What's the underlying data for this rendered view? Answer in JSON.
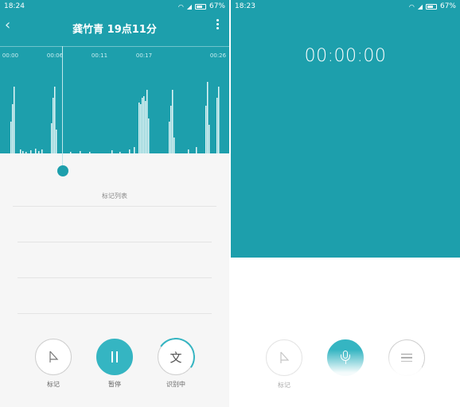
{
  "colors": {
    "teal": "#1d9fac",
    "accent": "#35b5c2",
    "panel": "#f6f6f6"
  },
  "left": {
    "status": {
      "time": "18:24",
      "battery": "67%"
    },
    "title": "龚竹青  19点11分",
    "timeline_ticks": [
      "00:00",
      "00:06",
      "00:11",
      "00:17",
      "00:26"
    ],
    "marks_list_title": "标记列表",
    "controls": {
      "mark_label": "标记",
      "pause_label": "暂停",
      "transcribe_label": "识别中",
      "transcribe_glyph": "文"
    },
    "icons": [
      "back-icon",
      "more-icon",
      "flag-icon",
      "pause-icon"
    ]
  },
  "right": {
    "status": {
      "time": "18:23",
      "battery": "67%"
    },
    "timer": "00:00:00",
    "controls": {
      "mark_label": "标记"
    },
    "icons": [
      "flag-icon",
      "mic-icon",
      "menu-icon"
    ]
  }
}
